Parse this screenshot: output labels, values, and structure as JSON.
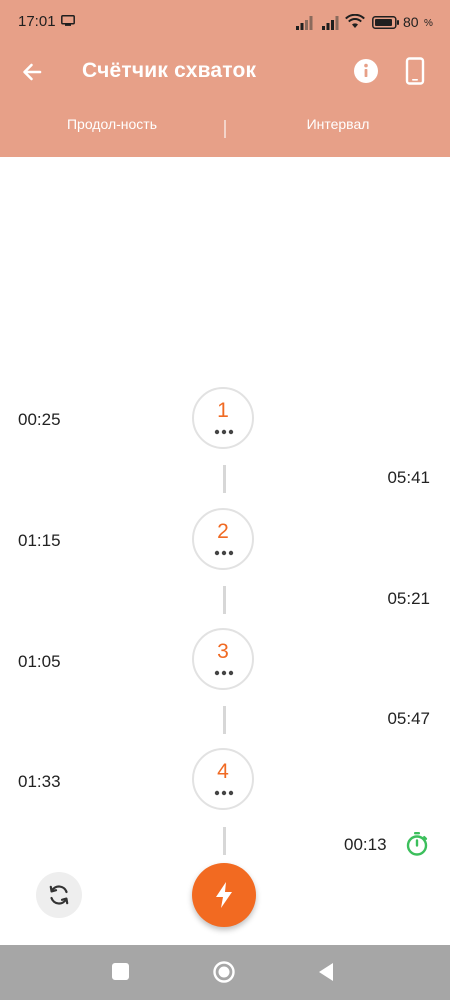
{
  "status_bar": {
    "time": "17:01",
    "battery": "80"
  },
  "app_bar": {
    "title": "Счётчик схваток",
    "tabs": [
      {
        "label": "Продол-ность"
      },
      {
        "label": "Интервал"
      }
    ]
  },
  "contractions": [
    {
      "number": "1",
      "duration": "00:25",
      "interval_after": "05:41"
    },
    {
      "number": "2",
      "duration": "01:15",
      "interval_after": "05:21"
    },
    {
      "number": "3",
      "duration": "01:05",
      "interval_after": "05:47"
    },
    {
      "number": "4",
      "duration": "01:33"
    }
  ],
  "current_interval": "00:13",
  "colors": {
    "header": "#e7a088",
    "accent": "#f26a21",
    "stopwatch": "#3cbf5c",
    "nav": "#a6a6a6"
  },
  "icons": {
    "back": "arrow-left-icon",
    "info": "info-icon",
    "phone": "phone-icon",
    "stopwatch": "stopwatch-icon",
    "reset": "refresh-icon",
    "start": "lightning-icon"
  }
}
